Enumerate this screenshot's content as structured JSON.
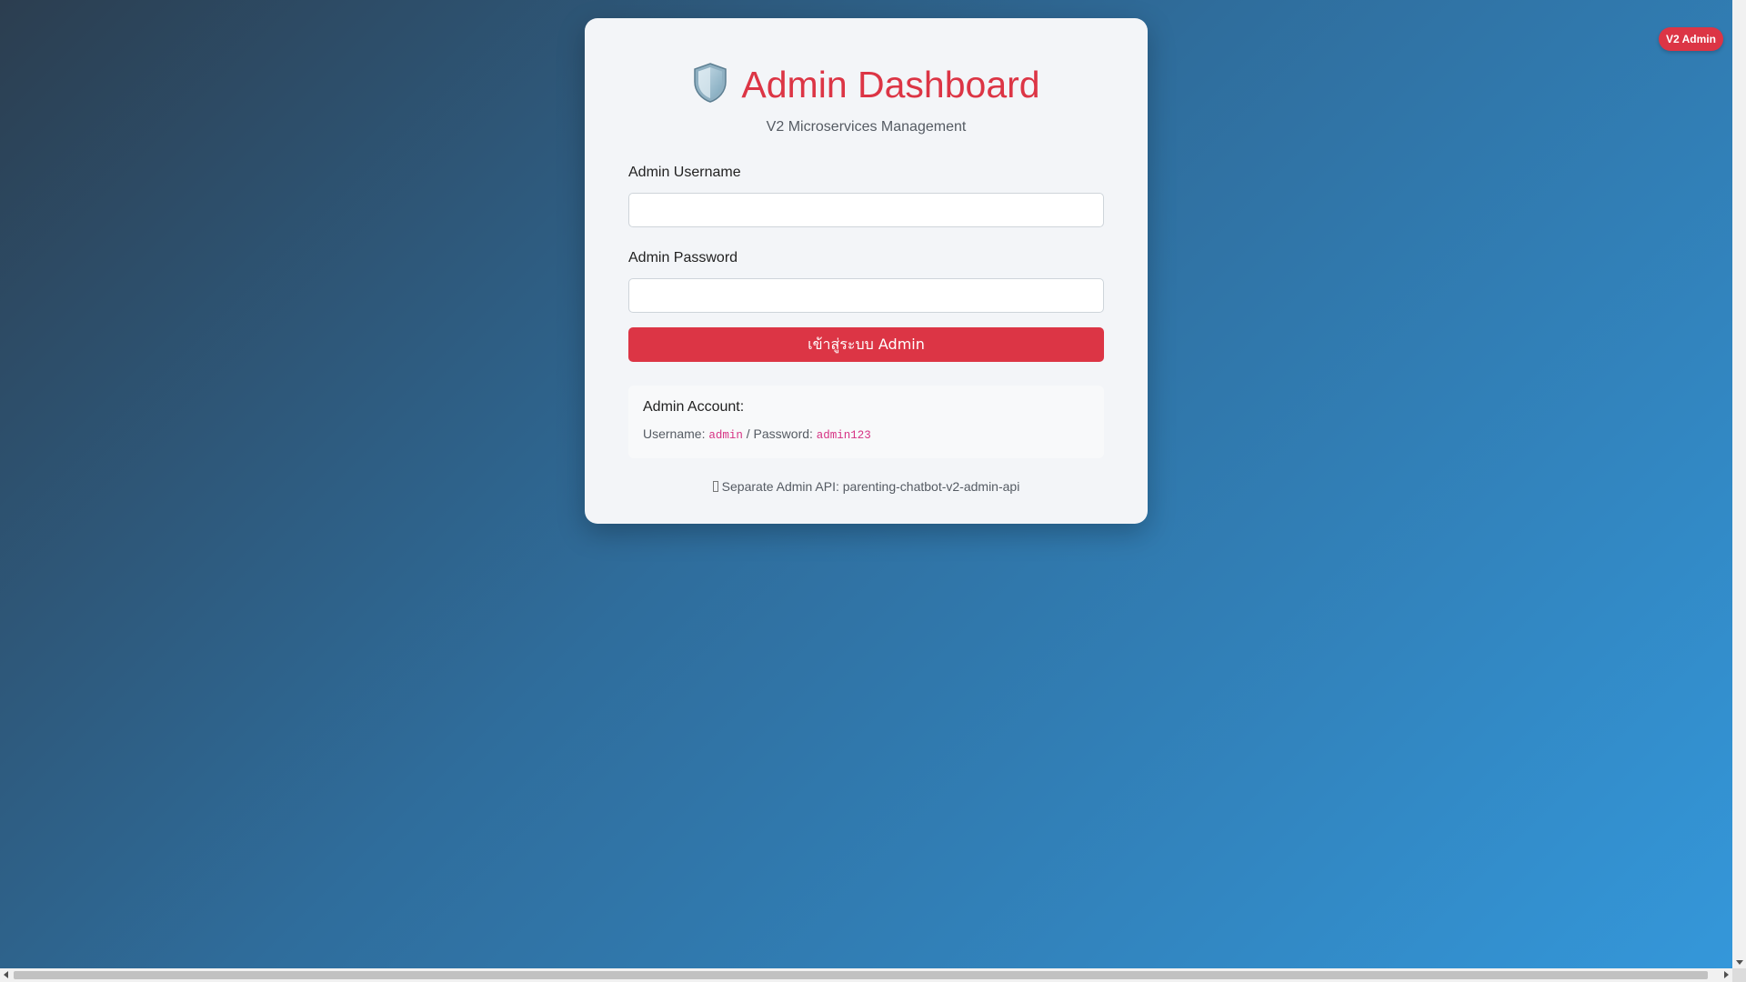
{
  "header": {
    "icon": "shield-icon",
    "title": "Admin Dashboard",
    "subtitle": "V2 Microservices Management"
  },
  "form": {
    "username_label": "Admin Username",
    "username_value": "",
    "password_label": "Admin Password",
    "password_value": "",
    "submit_label": "เข้าสู่ระบบ Admin"
  },
  "info": {
    "title": "Admin Account:",
    "username_prefix": "Username:",
    "username": "admin",
    "separator": "/ Password:",
    "password": "admin123"
  },
  "api_note": "Separate Admin API: parenting-chatbot-v2-admin-api",
  "badge": "V2 Admin",
  "colors": {
    "accent": "#dc3545",
    "code": "#d63384",
    "background_start": "#2c3e50",
    "background_end": "#3498db"
  }
}
